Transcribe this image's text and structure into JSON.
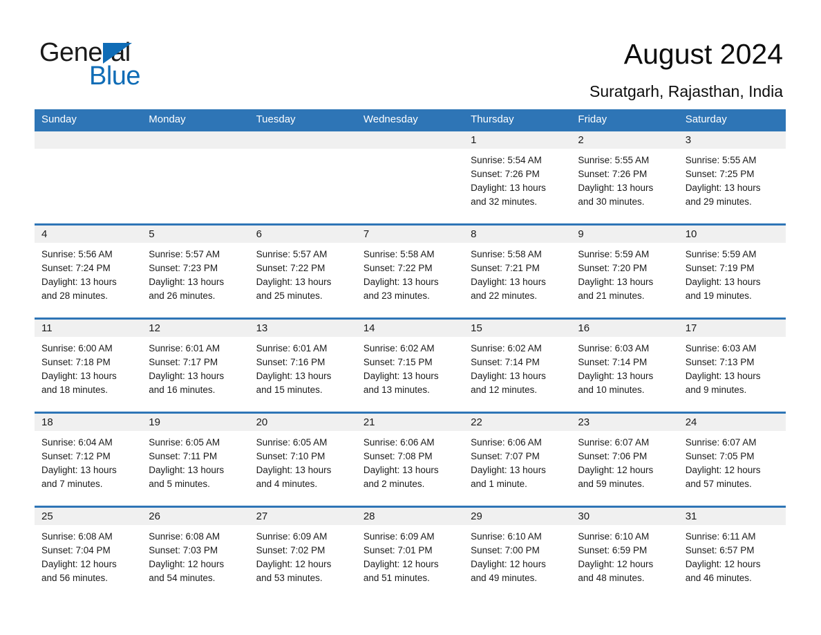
{
  "brand": {
    "name_top": "General",
    "name_bottom": "Blue",
    "accent_color": "#0f6cb6",
    "triangle_icon": "triangle-icon"
  },
  "header": {
    "title": "August 2024",
    "location": "Suratgarh, Rajasthan, India"
  },
  "calendar": {
    "header_bg": "#2e75b6",
    "date_band_bg": "#f0f0f0",
    "day_names": [
      "Sunday",
      "Monday",
      "Tuesday",
      "Wednesday",
      "Thursday",
      "Friday",
      "Saturday"
    ],
    "weeks": [
      [
        {
          "day": "",
          "lines": []
        },
        {
          "day": "",
          "lines": []
        },
        {
          "day": "",
          "lines": []
        },
        {
          "day": "",
          "lines": []
        },
        {
          "day": "1",
          "lines": [
            "Sunrise: 5:54 AM",
            "Sunset: 7:26 PM",
            "Daylight: 13 hours",
            "and 32 minutes."
          ]
        },
        {
          "day": "2",
          "lines": [
            "Sunrise: 5:55 AM",
            "Sunset: 7:26 PM",
            "Daylight: 13 hours",
            "and 30 minutes."
          ]
        },
        {
          "day": "3",
          "lines": [
            "Sunrise: 5:55 AM",
            "Sunset: 7:25 PM",
            "Daylight: 13 hours",
            "and 29 minutes."
          ]
        }
      ],
      [
        {
          "day": "4",
          "lines": [
            "Sunrise: 5:56 AM",
            "Sunset: 7:24 PM",
            "Daylight: 13 hours",
            "and 28 minutes."
          ]
        },
        {
          "day": "5",
          "lines": [
            "Sunrise: 5:57 AM",
            "Sunset: 7:23 PM",
            "Daylight: 13 hours",
            "and 26 minutes."
          ]
        },
        {
          "day": "6",
          "lines": [
            "Sunrise: 5:57 AM",
            "Sunset: 7:22 PM",
            "Daylight: 13 hours",
            "and 25 minutes."
          ]
        },
        {
          "day": "7",
          "lines": [
            "Sunrise: 5:58 AM",
            "Sunset: 7:22 PM",
            "Daylight: 13 hours",
            "and 23 minutes."
          ]
        },
        {
          "day": "8",
          "lines": [
            "Sunrise: 5:58 AM",
            "Sunset: 7:21 PM",
            "Daylight: 13 hours",
            "and 22 minutes."
          ]
        },
        {
          "day": "9",
          "lines": [
            "Sunrise: 5:59 AM",
            "Sunset: 7:20 PM",
            "Daylight: 13 hours",
            "and 21 minutes."
          ]
        },
        {
          "day": "10",
          "lines": [
            "Sunrise: 5:59 AM",
            "Sunset: 7:19 PM",
            "Daylight: 13 hours",
            "and 19 minutes."
          ]
        }
      ],
      [
        {
          "day": "11",
          "lines": [
            "Sunrise: 6:00 AM",
            "Sunset: 7:18 PM",
            "Daylight: 13 hours",
            "and 18 minutes."
          ]
        },
        {
          "day": "12",
          "lines": [
            "Sunrise: 6:01 AM",
            "Sunset: 7:17 PM",
            "Daylight: 13 hours",
            "and 16 minutes."
          ]
        },
        {
          "day": "13",
          "lines": [
            "Sunrise: 6:01 AM",
            "Sunset: 7:16 PM",
            "Daylight: 13 hours",
            "and 15 minutes."
          ]
        },
        {
          "day": "14",
          "lines": [
            "Sunrise: 6:02 AM",
            "Sunset: 7:15 PM",
            "Daylight: 13 hours",
            "and 13 minutes."
          ]
        },
        {
          "day": "15",
          "lines": [
            "Sunrise: 6:02 AM",
            "Sunset: 7:14 PM",
            "Daylight: 13 hours",
            "and 12 minutes."
          ]
        },
        {
          "day": "16",
          "lines": [
            "Sunrise: 6:03 AM",
            "Sunset: 7:14 PM",
            "Daylight: 13 hours",
            "and 10 minutes."
          ]
        },
        {
          "day": "17",
          "lines": [
            "Sunrise: 6:03 AM",
            "Sunset: 7:13 PM",
            "Daylight: 13 hours",
            "and 9 minutes."
          ]
        }
      ],
      [
        {
          "day": "18",
          "lines": [
            "Sunrise: 6:04 AM",
            "Sunset: 7:12 PM",
            "Daylight: 13 hours",
            "and 7 minutes."
          ]
        },
        {
          "day": "19",
          "lines": [
            "Sunrise: 6:05 AM",
            "Sunset: 7:11 PM",
            "Daylight: 13 hours",
            "and 5 minutes."
          ]
        },
        {
          "day": "20",
          "lines": [
            "Sunrise: 6:05 AM",
            "Sunset: 7:10 PM",
            "Daylight: 13 hours",
            "and 4 minutes."
          ]
        },
        {
          "day": "21",
          "lines": [
            "Sunrise: 6:06 AM",
            "Sunset: 7:08 PM",
            "Daylight: 13 hours",
            "and 2 minutes."
          ]
        },
        {
          "day": "22",
          "lines": [
            "Sunrise: 6:06 AM",
            "Sunset: 7:07 PM",
            "Daylight: 13 hours",
            "and 1 minute."
          ]
        },
        {
          "day": "23",
          "lines": [
            "Sunrise: 6:07 AM",
            "Sunset: 7:06 PM",
            "Daylight: 12 hours",
            "and 59 minutes."
          ]
        },
        {
          "day": "24",
          "lines": [
            "Sunrise: 6:07 AM",
            "Sunset: 7:05 PM",
            "Daylight: 12 hours",
            "and 57 minutes."
          ]
        }
      ],
      [
        {
          "day": "25",
          "lines": [
            "Sunrise: 6:08 AM",
            "Sunset: 7:04 PM",
            "Daylight: 12 hours",
            "and 56 minutes."
          ]
        },
        {
          "day": "26",
          "lines": [
            "Sunrise: 6:08 AM",
            "Sunset: 7:03 PM",
            "Daylight: 12 hours",
            "and 54 minutes."
          ]
        },
        {
          "day": "27",
          "lines": [
            "Sunrise: 6:09 AM",
            "Sunset: 7:02 PM",
            "Daylight: 12 hours",
            "and 53 minutes."
          ]
        },
        {
          "day": "28",
          "lines": [
            "Sunrise: 6:09 AM",
            "Sunset: 7:01 PM",
            "Daylight: 12 hours",
            "and 51 minutes."
          ]
        },
        {
          "day": "29",
          "lines": [
            "Sunrise: 6:10 AM",
            "Sunset: 7:00 PM",
            "Daylight: 12 hours",
            "and 49 minutes."
          ]
        },
        {
          "day": "30",
          "lines": [
            "Sunrise: 6:10 AM",
            "Sunset: 6:59 PM",
            "Daylight: 12 hours",
            "and 48 minutes."
          ]
        },
        {
          "day": "31",
          "lines": [
            "Sunrise: 6:11 AM",
            "Sunset: 6:57 PM",
            "Daylight: 12 hours",
            "and 46 minutes."
          ]
        }
      ]
    ]
  }
}
